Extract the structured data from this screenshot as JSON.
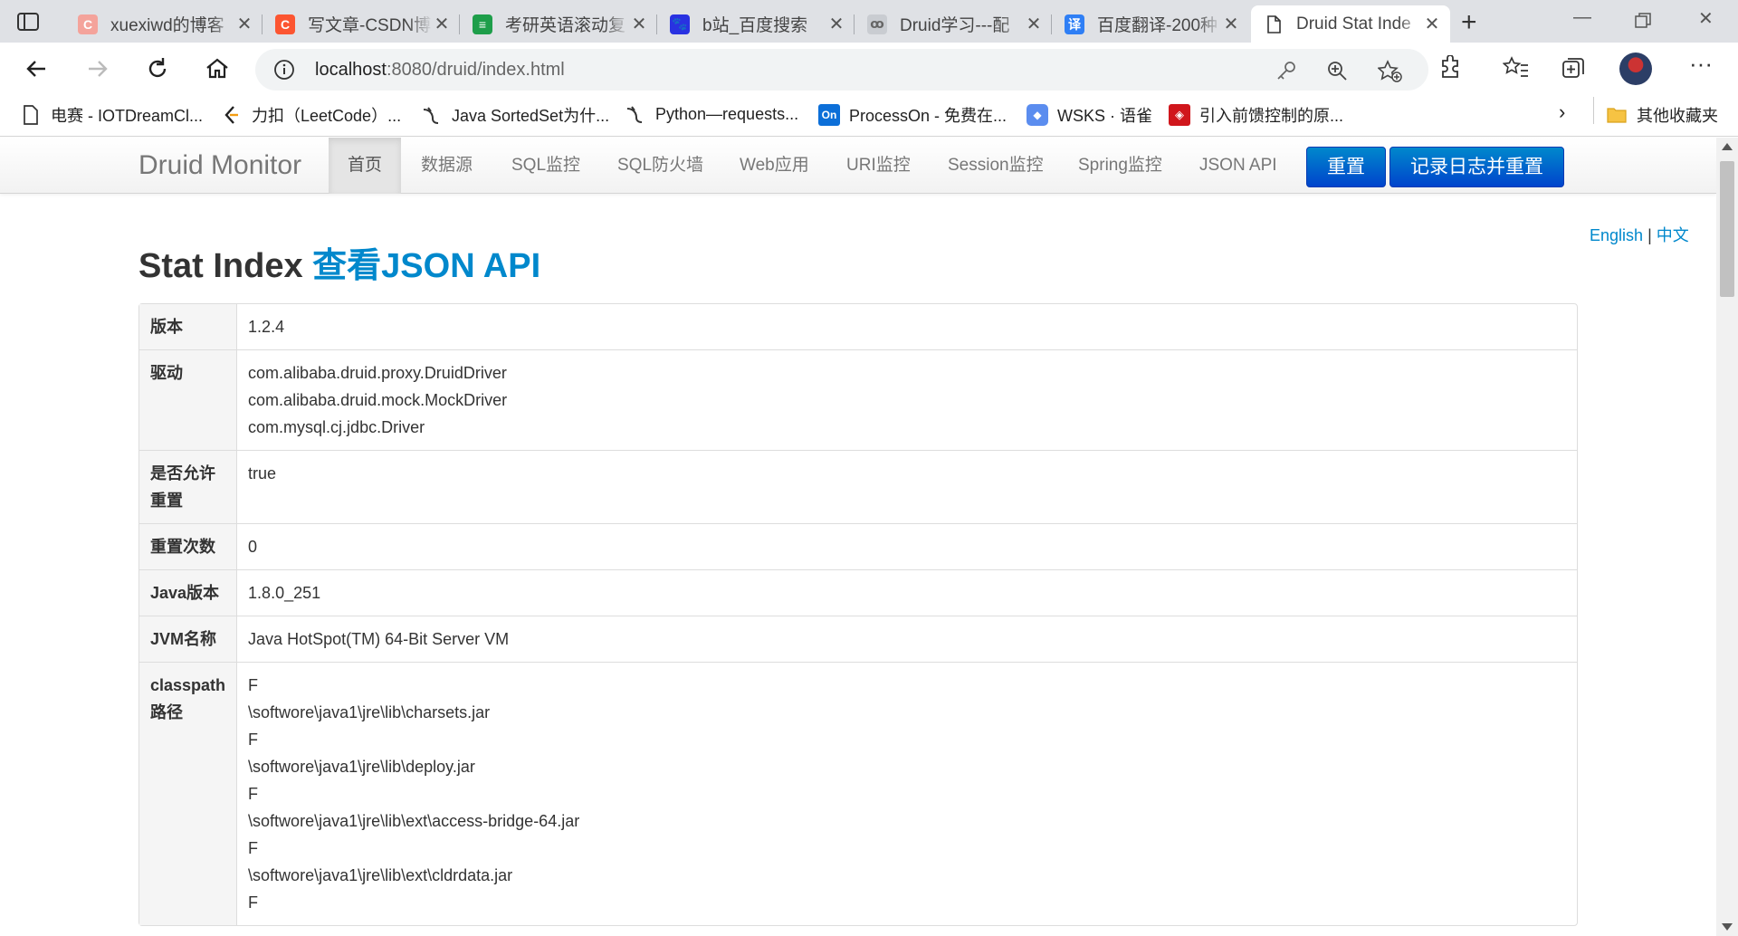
{
  "browser": {
    "tabs": [
      {
        "label": "xuexiwd的博客",
        "favicon": "C",
        "color": "#f4a39b"
      },
      {
        "label": "写文章-CSDN博",
        "favicon": "C",
        "color": "#fc5531"
      },
      {
        "label": "考研英语滚动复",
        "favicon": "≡",
        "color": "#1e9e4a"
      },
      {
        "label": "b站_百度搜索",
        "favicon": "🐾",
        "color": "#2932e1"
      },
      {
        "label": "Druid学习---配",
        "favicon": "ꝏ",
        "color": "#9aa0a6"
      },
      {
        "label": "百度翻译-200种",
        "favicon": "译",
        "color": "#2f7ff5"
      },
      {
        "label": "Druid Stat Inde",
        "favicon": "",
        "color": "#ffffff"
      }
    ],
    "url_host": "localhost",
    "url_rest": ":8080/druid/index.html",
    "bookmarks": [
      {
        "label": "电赛 - IOTDreamCl...",
        "icon": "page-icon"
      },
      {
        "label": "力扣（LeetCode）...",
        "icon": "leetcode-icon"
      },
      {
        "label": "Java SortedSet为什...",
        "icon": "yuque-icon"
      },
      {
        "label": "Python—requests...",
        "icon": "yuque-icon"
      },
      {
        "label": "ProcessOn - 免费在...",
        "icon": "processon-icon"
      },
      {
        "label": "WSKS · 语雀",
        "icon": "cube-icon"
      },
      {
        "label": "引入前馈控制的原...",
        "icon": "red-icon"
      }
    ],
    "other_bookmarks": "其他收藏夹"
  },
  "nav": {
    "brand": "Druid Monitor",
    "items": [
      "首页",
      "数据源",
      "SQL监控",
      "SQL防火墙",
      "Web应用",
      "URI监控",
      "Session监控",
      "Spring监控",
      "JSON API"
    ],
    "reset_label": "重置",
    "log_reset_label": "记录日志并重置"
  },
  "lang": {
    "english": "English",
    "sep": "|",
    "chinese": "中文"
  },
  "page": {
    "title": "Stat Index",
    "title_link": "查看JSON API"
  },
  "stats": [
    {
      "key": "版本",
      "values": [
        "1.2.4"
      ]
    },
    {
      "key": "驱动",
      "values": [
        "com.alibaba.druid.proxy.DruidDriver",
        "com.alibaba.druid.mock.MockDriver",
        "com.mysql.cj.jdbc.Driver"
      ]
    },
    {
      "key": "是否允许重置",
      "values": [
        "true"
      ]
    },
    {
      "key": "重置次数",
      "values": [
        "0"
      ]
    },
    {
      "key": "Java版本",
      "values": [
        "1.8.0_251"
      ]
    },
    {
      "key": "JVM名称",
      "values": [
        "Java HotSpot(TM) 64-Bit Server VM"
      ]
    },
    {
      "key": "classpath路径",
      "values": [
        "F",
        "\\softwore\\java1\\jre\\lib\\charsets.jar",
        "F",
        "\\softwore\\java1\\jre\\lib\\deploy.jar",
        "F",
        "\\softwore\\java1\\jre\\lib\\ext\\access-bridge-64.jar",
        "F",
        "\\softwore\\java1\\jre\\lib\\ext\\cldrdata.jar",
        "F"
      ]
    }
  ]
}
